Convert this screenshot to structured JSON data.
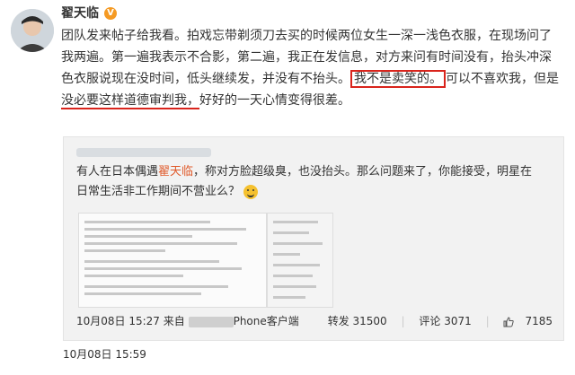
{
  "user": {
    "name": "翟天临",
    "badge": "V"
  },
  "post": {
    "text_a": "团队发来帖子给我看。拍戏忘带剃须刀去买的时候两位女生一深一浅色衣服，在现场问了我两遍。第一遍我表示不合影，第二遍，我正在发信息，对方来问有时间没有，抬头冲深色衣服说现在没时间，低头继续发，并没有不抬头。",
    "text_box": "我不是卖笑的。",
    "text_b": "可以不喜欢我，但是",
    "text_ul1": "没必要这样道德审",
    "text_ul2": "判我，",
    "text_c": "好好的一天心情变得很差。"
  },
  "quote": {
    "text_a": "有人在日本偶遇",
    "highlight": "翟天临",
    "text_b": "，称对方脸超级臭，也没抬头。那么问题来了，你能接受，明星在日常生活非工作期间不营业么？",
    "date": "10月08日 15:27 来自",
    "client": "Phone客户端",
    "repost": "转发 31500",
    "comment": "评论 3071",
    "likes": "7185"
  },
  "outer_date": "10月08日 15:59"
}
